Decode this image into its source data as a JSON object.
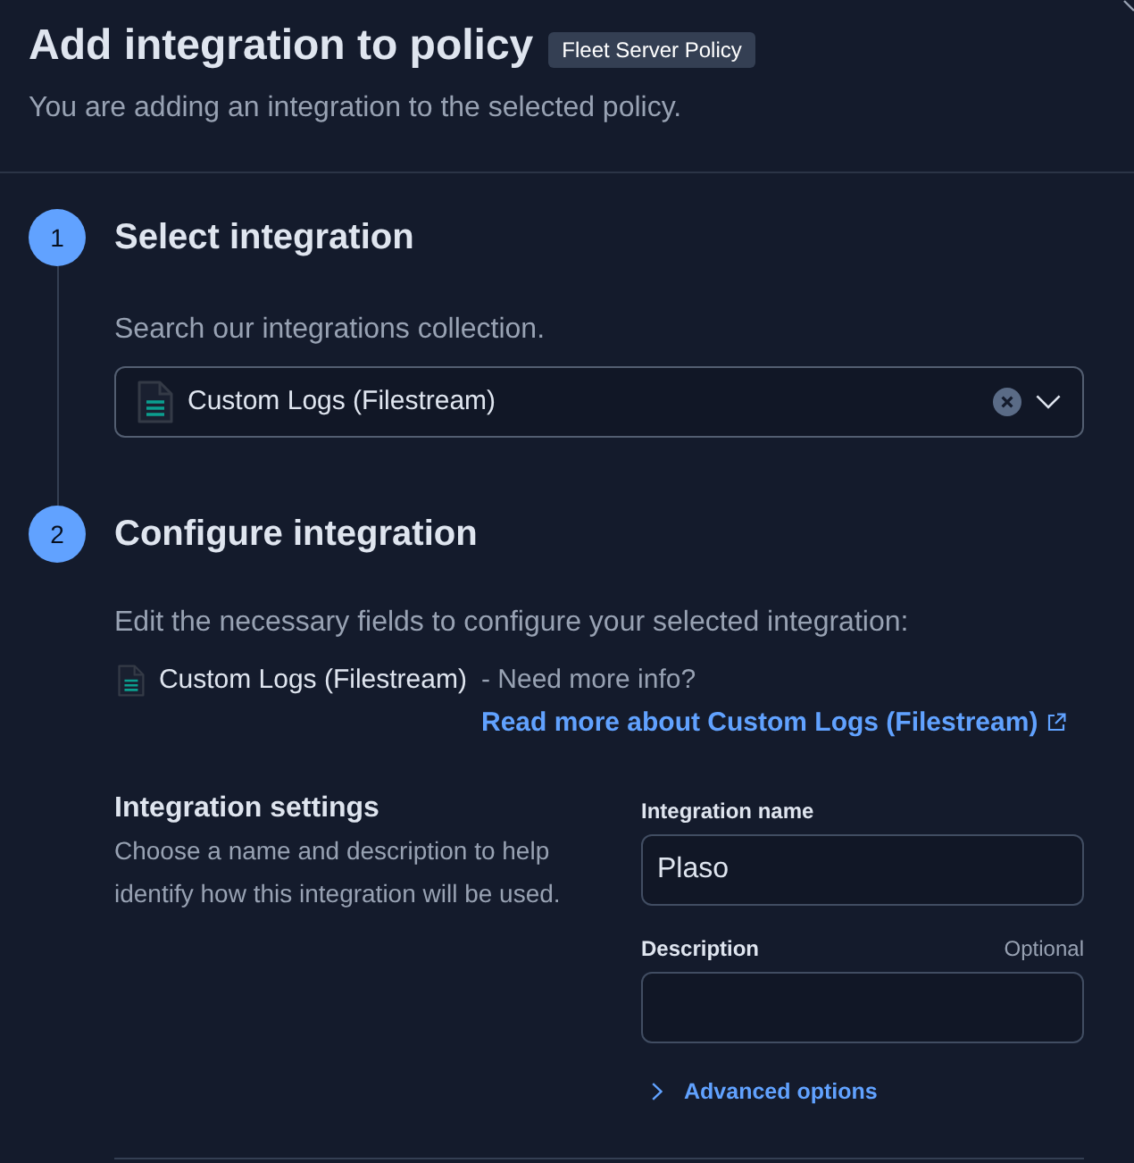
{
  "flyout": {
    "title": "Add integration to policy",
    "policy_badge": "Fleet Server Policy",
    "subtitle": "You are adding an integration to the selected policy."
  },
  "steps": [
    {
      "kind": "select",
      "number": "1",
      "title": "Select integration",
      "description": "Search our integrations collection.",
      "combo_box": {
        "value": "Custom Logs (Filestream)"
      }
    },
    {
      "kind": "configure",
      "number": "2",
      "title": "Configure integration",
      "description": "Edit the necessary fields to configure your selected integration:",
      "package_name": "Custom Logs (Filestream)",
      "info_prefix": "- Need more info?",
      "info_link": "Read more about Custom Logs (Filestream)",
      "settings": {
        "title": "Integration settings",
        "description": "Choose a name and description to help identify how this integration will be used.",
        "fields": [
          {
            "label": "Integration name",
            "value": "Plaso"
          },
          {
            "label": "Description",
            "optional_label": "Optional"
          }
        ],
        "advanced_options": {
          "label": "Advanced options",
          "expanded": false
        }
      }
    }
  ]
}
